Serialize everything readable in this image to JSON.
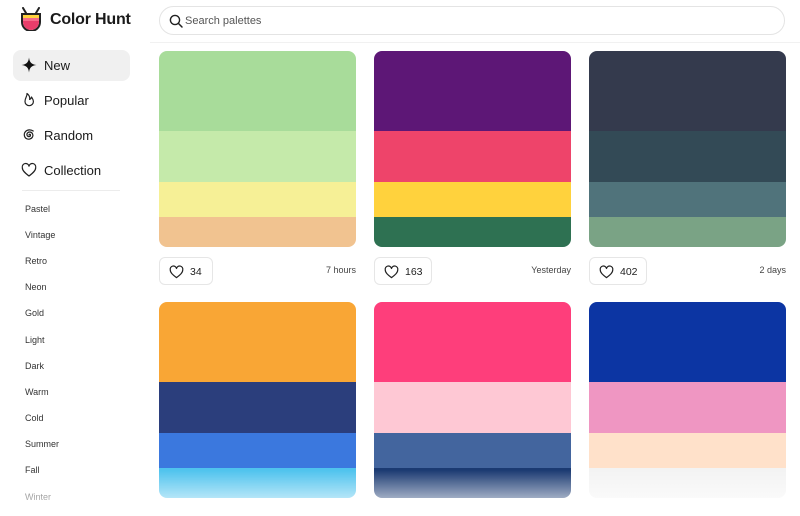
{
  "app": {
    "brand": "Color Hunt"
  },
  "search": {
    "placeholder": "Search palettes"
  },
  "nav": [
    {
      "label": "New",
      "icon": "sparkle-icon",
      "active": true
    },
    {
      "label": "Popular",
      "icon": "flame-icon",
      "active": false
    },
    {
      "label": "Random",
      "icon": "spiral-icon",
      "active": false
    },
    {
      "label": "Collection",
      "icon": "heart-icon",
      "active": false
    }
  ],
  "tags": [
    "Pastel",
    "Vintage",
    "Retro",
    "Neon",
    "Gold",
    "Light",
    "Dark",
    "Warm",
    "Cold",
    "Summer",
    "Fall",
    "Winter"
  ],
  "palettes": [
    {
      "colors": [
        "#A8DC9A",
        "#C5EAAA",
        "#F6F096",
        "#F1C390"
      ],
      "likes": "34",
      "time": "7 hours"
    },
    {
      "colors": [
        "#5D1776",
        "#EE446A",
        "#FFD23D",
        "#2E7152"
      ],
      "likes": "163",
      "time": "Yesterday"
    },
    {
      "colors": [
        "#343A4D",
        "#334A56",
        "#50737B",
        "#7AA385"
      ],
      "likes": "402",
      "time": "2 days"
    },
    {
      "colors": [
        "#F9A635",
        "#2B3E7C",
        "#3B78DE",
        "#4FC3EE"
      ],
      "likes": "",
      "time": ""
    },
    {
      "colors": [
        "#FE3E7B",
        "#FEC8D4",
        "#43659E",
        "#1B3A72"
      ],
      "likes": "",
      "time": ""
    },
    {
      "colors": [
        "#0C35A3",
        "#EF96C2",
        "#FFE1CA",
        "#F3F3F3"
      ],
      "likes": "",
      "time": ""
    }
  ]
}
